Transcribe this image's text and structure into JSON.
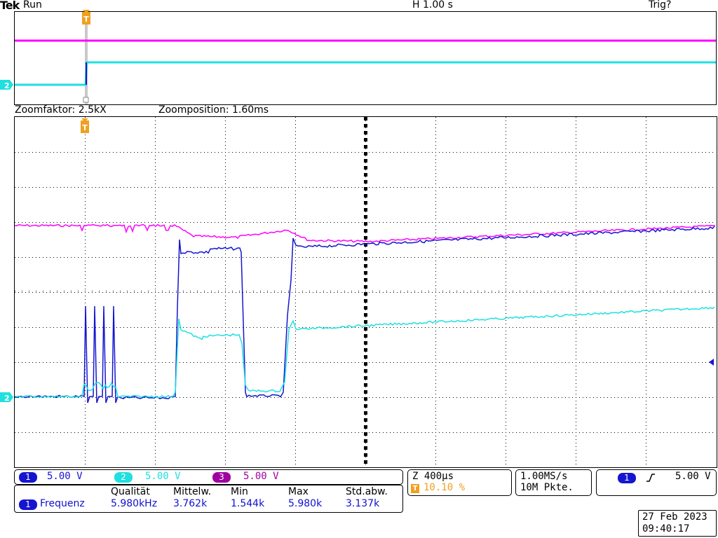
{
  "header": {
    "brand": "Tek",
    "run_state": "Run",
    "horizontal_scale": "H 1.00 s",
    "trigger_state": "Trig?"
  },
  "zoom": {
    "factor_label": "Zoomfaktor: 2.5kX",
    "position_label": "Zoomposition: 1.60ms"
  },
  "markers": {
    "trigger_glyph": "T",
    "channel2_marker": "2"
  },
  "channels": [
    {
      "number": "1",
      "scale": "5.00 V",
      "color": "#1515d0"
    },
    {
      "number": "2",
      "scale": "5.00 V",
      "color": "#1ee0e0"
    },
    {
      "number": "3",
      "scale": "5.00 V",
      "color": "#a000a0"
    }
  ],
  "measurement": {
    "source": "1",
    "name": "Frequenz",
    "headers": [
      "Qualität",
      "Mittelw.",
      "Min",
      "Max",
      "Std.abw."
    ],
    "values": [
      "5.980kHz",
      "3.762k",
      "1.544k",
      "5.980k",
      "3.137k"
    ]
  },
  "timebase": {
    "zoom_scale": "Z 400µs",
    "trigger_position": "10.10 %",
    "sample_rate": "1.00MS/s",
    "record_length": "10M Pkte."
  },
  "trigger": {
    "source": "1",
    "slope_icon": "rising-edge-icon",
    "level": "5.00 V"
  },
  "datetime": {
    "date": "27 Feb  2023",
    "time": "09:40:17"
  },
  "colors": {
    "ch1": "#1515d0",
    "ch2": "#1ee0e0",
    "ch3": "#ff00ff",
    "ch3_badge": "#a000a0",
    "trigger": "#f0a020",
    "grid": "#000000"
  }
}
